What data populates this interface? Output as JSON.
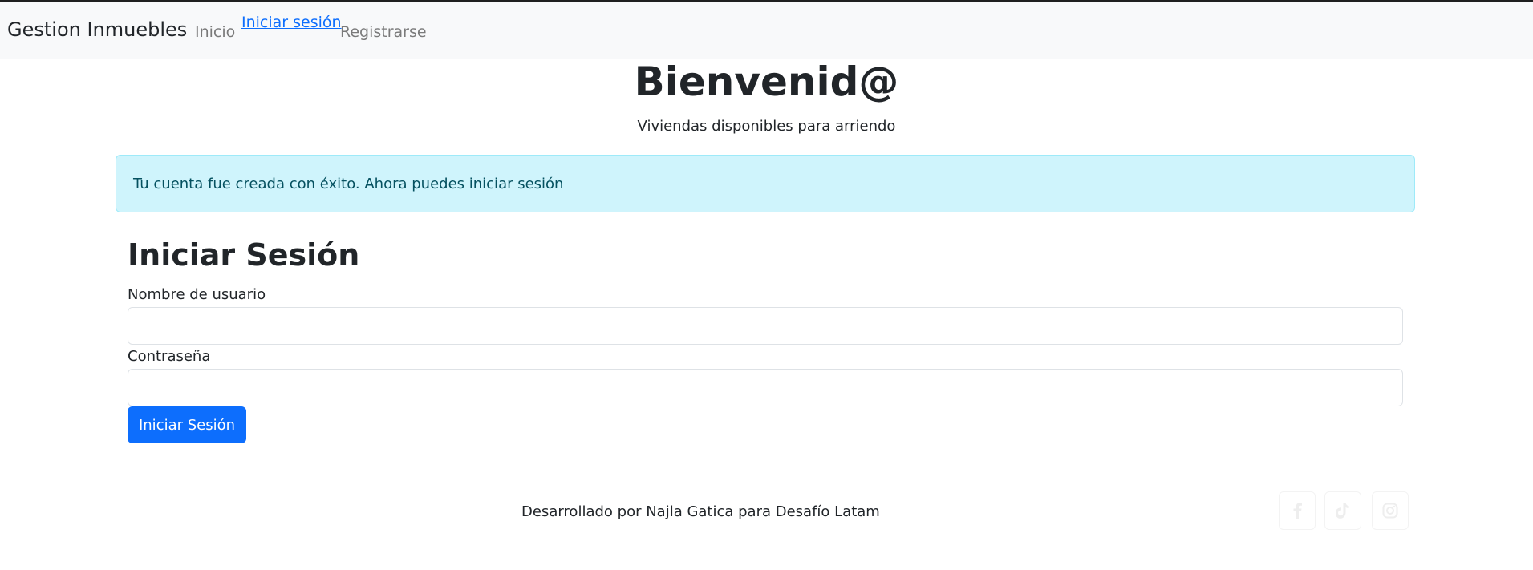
{
  "navbar": {
    "brand": "Gestion Inmuebles",
    "links": [
      {
        "label": "Inicio",
        "active": false
      },
      {
        "label": "Iniciar sesión",
        "active": true
      },
      {
        "label": "Registrarse",
        "active": false
      }
    ]
  },
  "hero": {
    "title": "Bienvenid@",
    "subtitle": "Viviendas disponibles para arriendo"
  },
  "alert": {
    "message": "Tu cuenta fue creada con éxito. Ahora puedes iniciar sesión",
    "type": "info"
  },
  "login_form": {
    "title": "Iniciar Sesión",
    "username_label": "Nombre de usuario",
    "username_value": "",
    "password_label": "Contraseña",
    "password_value": "",
    "submit_label": "Iniciar Sesión"
  },
  "footer": {
    "credit": "Desarrollado por Najla Gatica para Desafío Latam",
    "social": [
      {
        "icon": "facebook-icon"
      },
      {
        "icon": "tiktok-icon"
      },
      {
        "icon": "instagram-icon"
      }
    ]
  },
  "colors": {
    "primary": "#0d6efd",
    "navbar_bg": "#f8f9fa",
    "alert_bg": "#cff4fc",
    "alert_text": "#055160"
  }
}
